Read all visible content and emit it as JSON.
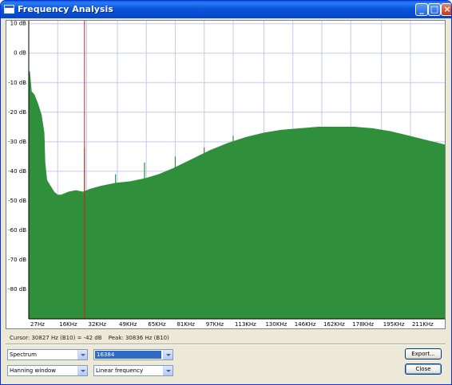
{
  "window": {
    "title": "Frequency Analysis"
  },
  "titlebar_buttons": {
    "minimize": "_",
    "maximize": "□",
    "close": "×"
  },
  "status": {
    "cursor": "Cursor: 30827 Hz (B10) = -42 dB",
    "peak": "Peak: 30836 Hz (B10)"
  },
  "controls": {
    "display_mode": "Spectrum",
    "fft_size": "16384",
    "window_function": "Hanning window",
    "axis_scale": "Linear frequency",
    "export_label": "Export...",
    "close_label": "Close"
  },
  "colors": {
    "fill": "#2f8f3a",
    "cursor_line": "#d22020",
    "grid": "#c8c8f0",
    "titlebar": "#0a5fe0"
  },
  "chart_data": {
    "type": "area",
    "y_ticks": [
      "10 dB",
      "0 dB",
      "-10 dB",
      "-20 dB",
      "-30 dB",
      "-40 dB",
      "-50 dB",
      "-60 dB",
      "-70 dB",
      "-80 dB"
    ],
    "x_ticks": [
      "27Hz",
      "16KHz",
      "32KHz",
      "49KHz",
      "65KHz",
      "81KHz",
      "97KHz",
      "113KHz",
      "130KHz",
      "146KHz",
      "162KHz",
      "178KHz",
      "195KHz",
      "211KHz"
    ],
    "x_tick_values_hz": [
      27,
      16000,
      32000,
      49000,
      65000,
      81000,
      97000,
      113000,
      130000,
      146000,
      162000,
      178000,
      195000,
      211000
    ],
    "ylim": [
      -90,
      11
    ],
    "xlim": [
      0,
      230000
    ],
    "grid": true,
    "cursor_hz": 30827,
    "series": [
      {
        "x": [
          0,
          500,
          1500,
          3000,
          5000,
          7000,
          8500,
          9000,
          10000,
          12000,
          14000,
          16000,
          18000,
          22000,
          26000,
          30000,
          34000,
          40000,
          48000,
          56000,
          64000,
          72000,
          80000,
          90000,
          100000,
          110000,
          120000,
          130000,
          140000,
          150000,
          160000,
          170000,
          180000,
          190000,
          200000,
          210000,
          220000,
          230000
        ],
        "y": [
          -10,
          -6,
          -13,
          -14,
          -17,
          -21,
          -27,
          -37,
          -43,
          -45,
          -47,
          -48,
          -48,
          -47,
          -46.5,
          -47,
          -46,
          -45,
          -44,
          -43.5,
          -42.5,
          -41,
          -39,
          -36,
          -33,
          -30.5,
          -28.5,
          -27,
          -26,
          -25.5,
          -25,
          -25,
          -25,
          -25.5,
          -26.5,
          -28,
          -29.5,
          -31
        ]
      }
    ],
    "spikes": [
      {
        "x": 30827,
        "y": -32
      },
      {
        "x": 48000,
        "y": -41
      },
      {
        "x": 64000,
        "y": -37
      },
      {
        "x": 81000,
        "y": -35
      },
      {
        "x": 97000,
        "y": -32
      },
      {
        "x": 113000,
        "y": -28
      }
    ]
  }
}
